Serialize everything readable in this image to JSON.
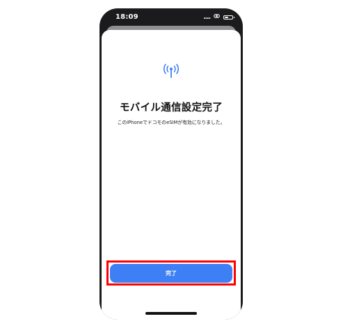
{
  "status_bar": {
    "time": "18:09",
    "signal": "....",
    "icons": [
      "signal-dots-icon",
      "link-icon",
      "battery-icon"
    ]
  },
  "sheet": {
    "icon": "antenna-icon",
    "title": "モバイル通信設定完了",
    "description": "このiPhoneでドコモのeSIMが有効になりました。",
    "done_button_label": "完了"
  },
  "colors": {
    "accent": "#3e7ff5",
    "highlight": "#ff0000",
    "frame": "#1b1b1d"
  }
}
